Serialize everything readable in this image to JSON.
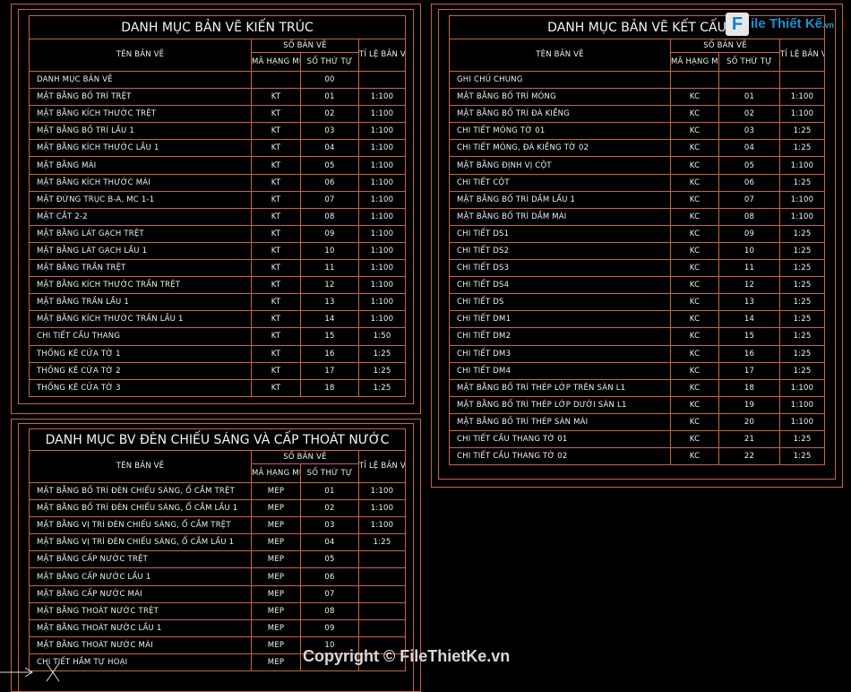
{
  "brand": {
    "logo_letter": "F",
    "logo_text": "ile Thiết Kế",
    "logo_suffix": ".vn"
  },
  "watermark": "Copyright © FileThietKe.vn",
  "headers": {
    "name": "TÊN BẢN VẼ",
    "group": "SỐ BẢN VẼ",
    "code": "MÃ HẠNG MỤC",
    "order": "SỐ THỨ TỰ",
    "scale": "TỈ LỆ BẢN VẼ"
  },
  "arch": {
    "title": "DANH MỤC BẢN VẼ KIẾN TRÚC",
    "rows": [
      [
        "DANH MỤC BẢN VẼ",
        "",
        "00",
        ""
      ],
      [
        "MẶT BẰNG  BỐ TRÍ TRỆT",
        "KT",
        "01",
        "1:100"
      ],
      [
        "MẶT BẰNG KÍCH THƯỚC TRỆT",
        "KT",
        "02",
        "1:100"
      ],
      [
        "MẶT BẰNG  BỐ TRÍ LẦU 1",
        "KT",
        "03",
        "1:100"
      ],
      [
        "MẶT BẰNG KÍCH THƯỚC LẦU 1",
        "KT",
        "04",
        "1:100"
      ],
      [
        "MẶT BẰNG  MÁI",
        "KT",
        "05",
        "1:100"
      ],
      [
        "MẶT BẰNG KÍCH THƯỚC MÁI",
        "KT",
        "06",
        "1:100"
      ],
      [
        "MẶT ĐỨNG TRỤC B-A, MC 1-1",
        "KT",
        "07",
        "1:100"
      ],
      [
        "MẶT CẮT 2-2",
        "KT",
        "08",
        "1:100"
      ],
      [
        "MẶT BẰNG LÁT GẠCH TRỆT",
        "KT",
        "09",
        "1:100"
      ],
      [
        "MẶT BẰNG LÁT GẠCH LẦU 1",
        "KT",
        "10",
        "1:100"
      ],
      [
        "MẶT BẰNG TRẦN TRỆT",
        "KT",
        "11",
        "1:100"
      ],
      [
        "MẶT BẰNG KÍCH THƯỚC TRẦN TRỆT",
        "KT",
        "12",
        "1:100"
      ],
      [
        "MẶT BẰNG TRẦN LẦU 1",
        "KT",
        "13",
        "1:100"
      ],
      [
        "MẶT BẰNG KÍCH THƯỚC TRẦN LẦU 1",
        "KT",
        "14",
        "1:100"
      ],
      [
        "CHI TIẾT CẦU THANG",
        "KT",
        "15",
        "1:50"
      ],
      [
        "THỐNG KÊ CỬA TỜ 1",
        "KT",
        "16",
        "1:25"
      ],
      [
        "THỐNG KÊ CỬA TỜ 2",
        "KT",
        "17",
        "1:25"
      ],
      [
        "THỐNG KÊ CỬA TỜ 3",
        "KT",
        "18",
        "1:25"
      ]
    ]
  },
  "struct": {
    "title": "DANH MỤC BẢN VẼ KẾT CẤU",
    "rows": [
      [
        "GHI CHÚ CHUNG",
        "",
        "",
        ""
      ],
      [
        "MẶT BẰNG BỐ TRÍ MÓNG",
        "KC",
        "01",
        "1:100"
      ],
      [
        "MẶT BẰNG BỐ TRÍ ĐÀ KIỀNG",
        "KC",
        "02",
        "1:100"
      ],
      [
        "CHI TIẾT MÓNG TỜ 01",
        "KC",
        "03",
        "1:25"
      ],
      [
        "CHI TIẾT MÓNG, ĐÀ KIỀNG TỜ 02",
        "KC",
        "04",
        "1:25"
      ],
      [
        "MẶT BẰNG ĐỊNH VỊ CỘT",
        "KC",
        "05",
        "1:100"
      ],
      [
        "CHI TIẾT CỘT",
        "KC",
        "06",
        "1:25"
      ],
      [
        "MẶT BẰNG BỐ TRÍ DẦM LẦU 1",
        "KC",
        "07",
        "1:100"
      ],
      [
        "MẶT BẰNG BỐ TRÍ DẦM MÁI",
        "KC",
        "08",
        "1:100"
      ],
      [
        "CHI TIẾT DS1",
        "KC",
        "09",
        "1:25"
      ],
      [
        "CHI TIẾT DS2",
        "KC",
        "10",
        "1:25"
      ],
      [
        "CHI TIẾT DS3",
        "KC",
        "11",
        "1:25"
      ],
      [
        "CHI TIẾT DS4",
        "KC",
        "12",
        "1:25"
      ],
      [
        "CHI TIẾT DS",
        "KC",
        "13",
        "1:25"
      ],
      [
        "CHI TIẾT DM1",
        "KC",
        "14",
        "1:25"
      ],
      [
        "CHI TIẾT DM2",
        "KC",
        "15",
        "1:25"
      ],
      [
        "CHI TIẾT DM3",
        "KC",
        "16",
        "1:25"
      ],
      [
        "CHI TIẾT DM4",
        "KC",
        "17",
        "1:25"
      ],
      [
        "MẶT BẰNG BỐ TRÍ THÉP LỚP TRÊN SÀN L1",
        "KC",
        "18",
        "1:100"
      ],
      [
        "MẶT BẰNG BỐ TRÍ THÉP LỚP DƯỚI SÀN L1",
        "KC",
        "19",
        "1:100"
      ],
      [
        "MẶT BẰNG BỐ TRÍ THÉP SÀN MÁI",
        "KC",
        "20",
        "1:100"
      ],
      [
        "CHI TIẾT CẦU THANG TỜ 01",
        "KC",
        "21",
        "1:25"
      ],
      [
        "CHI TIẾT CẦU THANG TỜ 02",
        "KC",
        "22",
        "1:25"
      ]
    ]
  },
  "mep": {
    "title": "DANH MỤC BV ĐÈN CHIẾU SÁNG VÀ CẤP THOÁT NƯỚC",
    "rows": [
      [
        "MẶT BẰNG BỐ TRÍ ĐÈN CHIẾU SÁNG, Ổ CẮM TRỆT",
        "MEP",
        "01",
        "1:100"
      ],
      [
        "MẶT BẰNG BỐ TRÍ ĐÈN CHIẾU SÁNG, Ổ CẮM LẦU 1",
        "MEP",
        "02",
        "1:100"
      ],
      [
        "MẶT BẰNG VỊ TRÍ  ĐÈN CHIẾU SÁNG, Ổ CẮM TRỆT",
        "MEP",
        "03",
        "1:100"
      ],
      [
        "MẶT BẰNG VỊ TRÍ ĐÈN CHIẾU SÁNG, Ổ CẮM LẦU 1",
        "MEP",
        "04",
        "1:25"
      ],
      [
        "MẶT BẰNG CẤP NƯỚC TRỆT",
        "MEP",
        "05",
        ""
      ],
      [
        "MẶT BẰNG CẤP NƯỚC LẦU 1",
        "MEP",
        "06",
        ""
      ],
      [
        "MẶT BẰNG CẤP NƯỚC MÁI",
        "MEP",
        "07",
        ""
      ],
      [
        "MẶT BẰNG THOÁT NƯỚC TRỆT",
        "MEP",
        "08",
        ""
      ],
      [
        "MẶT BẰNG THOÁT NƯỚC LẦU 1",
        "MEP",
        "09",
        ""
      ],
      [
        "MẶT BẰNG THOÁT NƯỚC MÁI",
        "MEP",
        "10",
        ""
      ],
      [
        "CHI TIẾT HẦM TỰ HOẠI",
        "MEP",
        "",
        ""
      ]
    ]
  }
}
